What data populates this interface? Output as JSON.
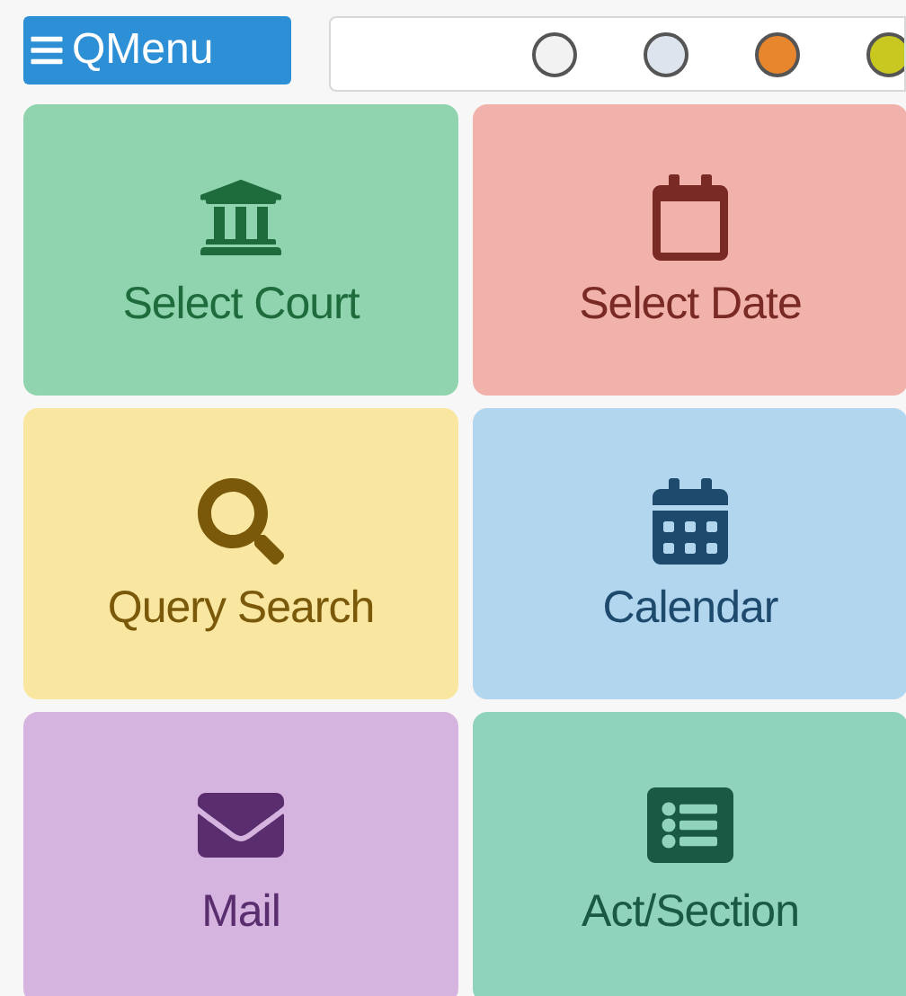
{
  "menu_button": {
    "label": "QMenu"
  },
  "status_dots": [
    {
      "color": "#f2f2f2"
    },
    {
      "color": "#dde4ee"
    },
    {
      "color": "#e8862e"
    },
    {
      "color": "#c8c820"
    }
  ],
  "tiles": [
    {
      "label": "Select Court",
      "color": "#8fd4ae"
    },
    {
      "label": "Select Date",
      "color": "#f2b2ac"
    },
    {
      "label": "Query Search",
      "color": "#f9e6a0"
    },
    {
      "label": "Calendar",
      "color": "#b3d6ef"
    },
    {
      "label": "Mail",
      "color": "#d6b4e0"
    },
    {
      "label": "Act/Section",
      "color": "#90d3bc"
    }
  ]
}
